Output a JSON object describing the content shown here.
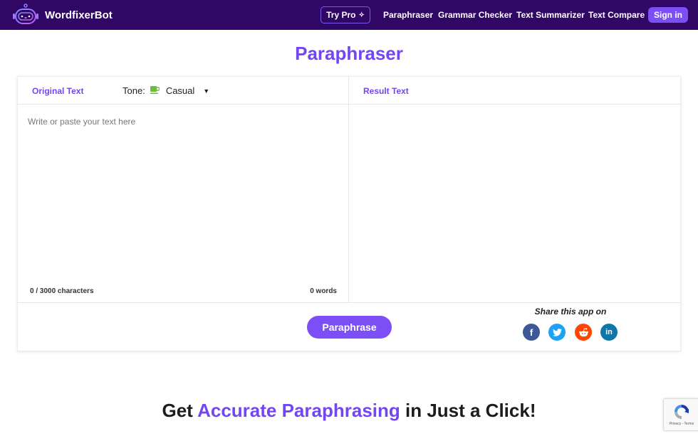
{
  "nav": {
    "brand": "WordfixerBot",
    "try_pro": "Try Pro",
    "links": [
      "Paraphraser",
      "Grammar Checker",
      "Text Summarizer",
      "Text Compare"
    ],
    "sign_in": "Sign in"
  },
  "page": {
    "title": "Paraphraser"
  },
  "editor": {
    "original_label": "Original Text",
    "tone_label": "Tone:",
    "tone_value": "Casual",
    "placeholder": "Write or paste your text here",
    "char_count": "0 / 3000 characters",
    "word_count": "0 words",
    "result_label": "Result Text",
    "paraphrase_button": "Paraphrase"
  },
  "share": {
    "label": "Share this app on",
    "networks": [
      {
        "name": "facebook",
        "glyph": "f",
        "color": "#3b5998"
      },
      {
        "name": "twitter",
        "glyph": "t",
        "color": "#1da1f2"
      },
      {
        "name": "reddit",
        "glyph": "r",
        "color": "#ff4500"
      },
      {
        "name": "linkedin",
        "glyph": "in",
        "color": "#0e76a8"
      }
    ]
  },
  "hero": {
    "prefix": "Get ",
    "accent": "Accurate Paraphrasing",
    "suffix": " in Just a Click!"
  },
  "recaptcha": {
    "text": "Privacy - Terms"
  },
  "colors": {
    "nav_bg": "#300764",
    "accent": "#7c4ff6",
    "title": "#7445f2"
  }
}
